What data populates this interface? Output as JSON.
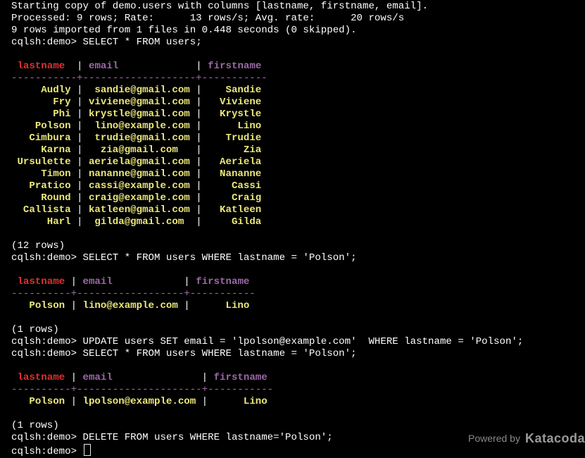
{
  "terminal": {
    "intro": [
      "Starting copy of demo.users with columns [lastname, firstname, email].",
      "Processed: 9 rows; Rate:      13 rows/s; Avg. rate:      20 rows/s",
      "9 rows imported from 1 files in 0.448 seconds (0 skipped)."
    ],
    "prompt": "cqlsh:demo> ",
    "commands": [
      "SELECT * FROM users;",
      "SELECT * FROM users WHERE lastname = 'Polson';",
      "UPDATE users SET email = 'lpolson@example.com'  WHERE lastname = 'Polson';",
      "SELECT * FROM users WHERE lastname = 'Polson';",
      "DELETE FROM users WHERE lastname='Polson';"
    ],
    "columns": [
      "lastname",
      "email",
      "firstname"
    ],
    "table1": {
      "rows": [
        [
          "Audly",
          "sandie@gmail.com",
          "Sandie"
        ],
        [
          "Fry",
          "viviene@gmail.com",
          "Viviene"
        ],
        [
          "Phi",
          "krystle@gmail.com",
          "Krystle"
        ],
        [
          "Polson",
          "lino@example.com",
          "Lino"
        ],
        [
          "Cimbura",
          "trudie@gmail.com",
          "Trudie"
        ],
        [
          "Karna",
          "zia@gmail.com",
          "Zia"
        ],
        [
          "Ursulette",
          "aeriela@gmail.com",
          "Aeriela"
        ],
        [
          "Timon",
          "nananne@gmail.com",
          "Nananne"
        ],
        [
          "Pratico",
          "cassi@example.com",
          "Cassi"
        ],
        [
          "Round",
          "craig@example.com",
          "Craig"
        ],
        [
          "Callista",
          "katleen@gmail.com",
          "Katleen"
        ],
        [
          "Harl",
          "gilda@gmail.com",
          "Gilda"
        ]
      ],
      "count": "(12 rows)"
    },
    "table2": {
      "rows": [
        [
          "Polson",
          "lino@example.com",
          "Lino"
        ]
      ],
      "count": "(1 rows)"
    },
    "table3": {
      "rows": [
        [
          "Polson",
          "lpolson@example.com",
          "Lino"
        ]
      ],
      "count": "(1 rows)"
    }
  },
  "footer": {
    "powered_by": "Powered by",
    "brand": "Katacoda"
  },
  "colors": {
    "background": "#000000",
    "text": "#ffffff",
    "header_lastname": "#e0302f",
    "header_other": "#9c6aa8",
    "cell_values": "#ebe87a"
  }
}
